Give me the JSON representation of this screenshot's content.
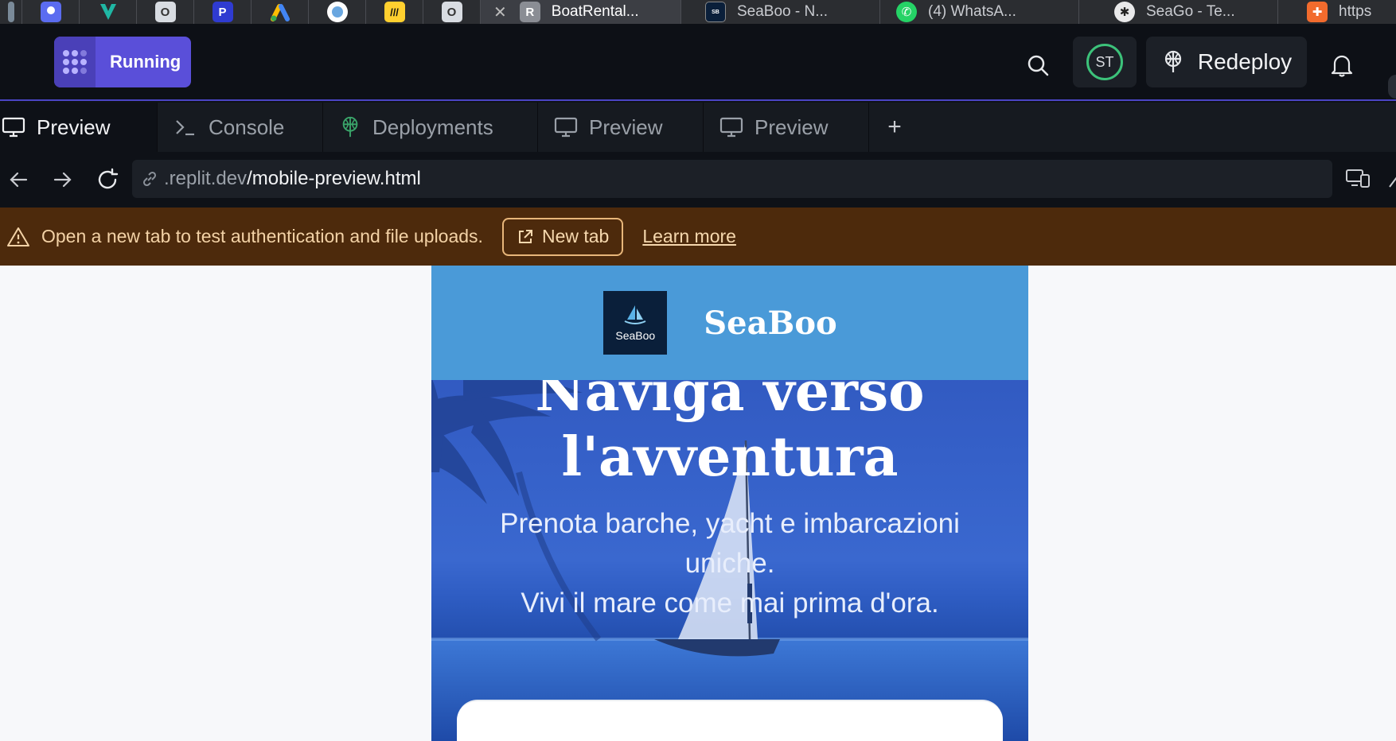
{
  "browser_tabs": {
    "pinned": [
      {
        "icon": "app-icon-1",
        "color": "#5b6cf0"
      },
      {
        "icon": "vercel-like-icon",
        "color": "#1fb7a4"
      },
      {
        "icon": "o-app-icon",
        "color": "#d8dce2"
      },
      {
        "icon": "p-app-icon",
        "color": "#2f3bd1"
      },
      {
        "icon": "google-ads-icon",
        "color": "#fbbc04"
      },
      {
        "icon": "globe-app-icon",
        "color": "#ffffff"
      },
      {
        "icon": "miro-icon",
        "color": "#ffd02f"
      },
      {
        "icon": "o-app-icon-2",
        "color": "#d8dce2"
      }
    ],
    "tabs": [
      {
        "title": "BoatRental...",
        "letter": "R",
        "active": true
      },
      {
        "title": "SeaBoo - N...",
        "icon": "seaboo-icon"
      },
      {
        "title": "(4) WhatsA...",
        "icon": "whatsapp-icon"
      },
      {
        "title": "SeaGo - Te...",
        "icon": "chatgpt-icon"
      },
      {
        "title": "https",
        "icon": "orange-app-icon"
      }
    ]
  },
  "header": {
    "run_label": "Running",
    "avatar_initials": "ST",
    "redeploy_label": "Redeploy",
    "accent": "#5a4fd9"
  },
  "panel_tabs": [
    {
      "label": "Preview",
      "icon": "monitor-icon",
      "active": true
    },
    {
      "label": "Console",
      "icon": "terminal-icon"
    },
    {
      "label": "Deployments",
      "icon": "deploy-icon"
    },
    {
      "label": "Preview",
      "icon": "monitor-icon"
    },
    {
      "label": "Preview",
      "icon": "monitor-icon"
    }
  ],
  "url": {
    "host": ".replit.dev",
    "path": "/mobile-preview.html"
  },
  "banner": {
    "message": "Open a new tab to test authentication and file uploads.",
    "new_tab_label": "New tab",
    "learn_more_label": "Learn more",
    "bg": "#4d2a0c"
  },
  "site": {
    "logo_text": "SeaBoo",
    "brand": "SeaBoo",
    "hero_title_line1": "Naviga verso",
    "hero_title_line2": "l'avventura",
    "hero_sub_line1": "Prenota barche, yacht e imbarcazioni",
    "hero_sub_line2": "uniche.",
    "hero_sub_line3": "Vivi il mare come mai prima d'ora.",
    "header_color": "#4a9ad8"
  }
}
